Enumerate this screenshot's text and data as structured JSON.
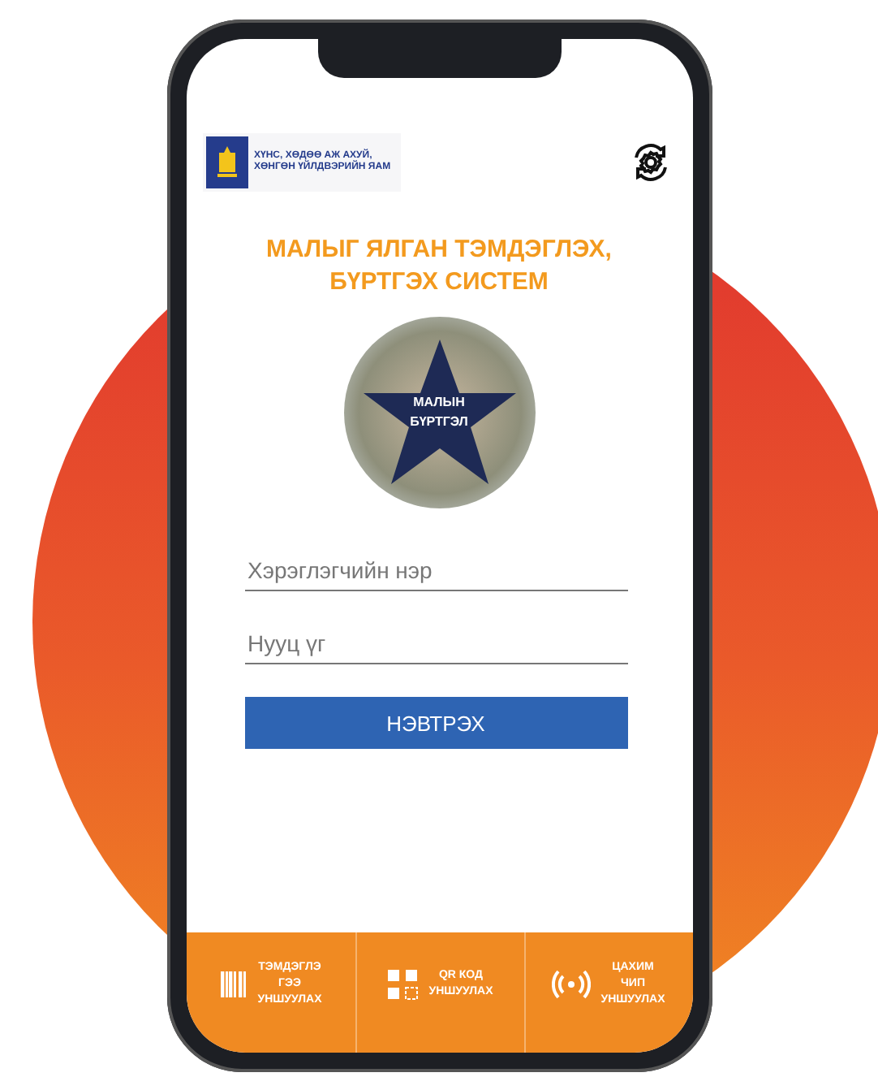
{
  "header": {
    "ministry_lines": [
      "ХҮНС, ХӨДӨӨ АЖ АХУЙ,",
      "ХӨНГӨН ҮЙЛДВЭРИЙН ЯАМ"
    ]
  },
  "title_lines": [
    "МАЛЫГ ЯЛГАН ТЭМДЭГЛЭХ,",
    "БҮРТГЭХ СИСТЕМ"
  ],
  "emblem_lines": [
    "МАЛЫН",
    "БҮРТГЭЛ"
  ],
  "fields": [
    {
      "placeholder": "Хэрэглэгчийн нэр"
    },
    {
      "placeholder": "Нууц үг"
    }
  ],
  "login_button": "НЭВТРЭХ",
  "bottom_nav": [
    {
      "kind": "barcode",
      "lines": [
        "ТЭМДЭГЛЭ",
        "ГЭЭ",
        "УНШУУЛАХ"
      ]
    },
    {
      "kind": "qr",
      "lines": [
        "QR КОД",
        "УНШУУЛАХ"
      ]
    },
    {
      "kind": "chip",
      "lines": [
        "ЦАХИМ",
        "ЧИП",
        "УНШУУЛАХ"
      ]
    }
  ]
}
